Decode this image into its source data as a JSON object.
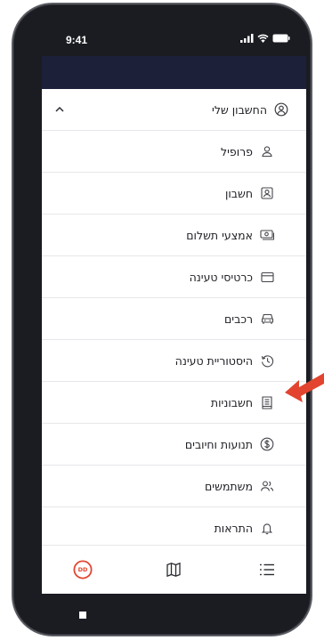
{
  "status_bar": {
    "time": "9:41"
  },
  "menu": {
    "section_title": "החשבון שלי",
    "items": [
      {
        "label": "פרופיל",
        "icon": "user-icon"
      },
      {
        "label": "חשבון",
        "icon": "id-card-icon"
      },
      {
        "label": "אמצעי תשלום",
        "icon": "cash-icon"
      },
      {
        "label": "כרטיסי טעינה",
        "icon": "credit-card-icon"
      },
      {
        "label": "רכבים",
        "icon": "car-icon"
      },
      {
        "label": "היסטוריית טעינה",
        "icon": "history-icon"
      },
      {
        "label": "חשבוניות",
        "icon": "invoice-icon"
      },
      {
        "label": "תנועות וחיובים",
        "icon": "dollar-icon"
      },
      {
        "label": "משתמשים",
        "icon": "users-icon"
      },
      {
        "label": "התראות",
        "icon": "bell-icon"
      }
    ]
  },
  "bottom_nav": {
    "logo_text": "DD"
  },
  "colors": {
    "accent_red": "#e2442f",
    "arrow": "#e2442f",
    "header_navy": "#1c2039"
  }
}
